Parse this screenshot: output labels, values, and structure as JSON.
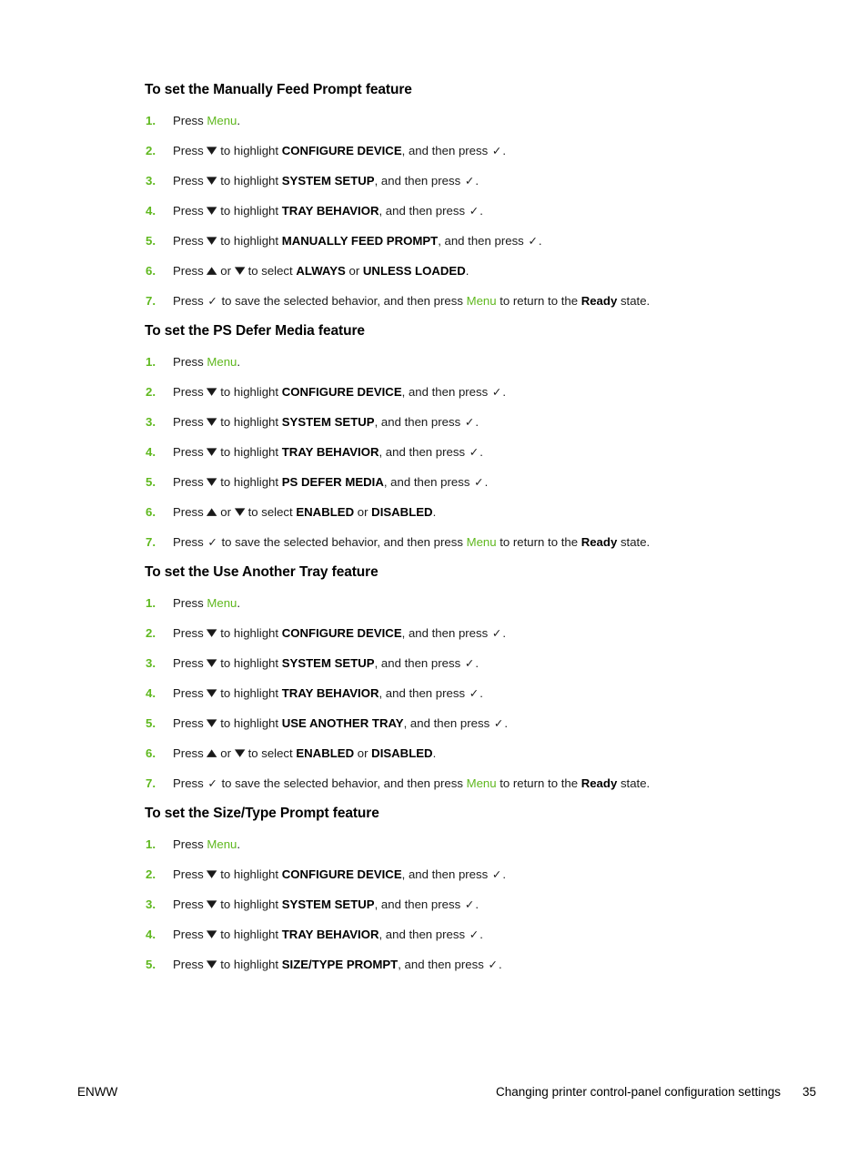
{
  "page": {
    "background_color": "#ffffff",
    "accent_green": "#5FB81E"
  },
  "glyphs": {
    "down_arrow": "▼",
    "up_arrow": "▲",
    "check": "✓"
  },
  "sections": [
    {
      "heading": "To set the Manually Feed Prompt feature",
      "steps": [
        {
          "number": "1.",
          "parts": [
            {
              "type": "text",
              "value": "Press "
            },
            {
              "type": "menu",
              "value": "Menu"
            },
            {
              "type": "text",
              "value": "."
            }
          ]
        },
        {
          "number": "2.",
          "parts": [
            {
              "type": "text",
              "value": "Press "
            },
            {
              "type": "glyph",
              "value": "down_arrow"
            },
            {
              "type": "text",
              "value": " to highlight "
            },
            {
              "type": "bold",
              "value": "CONFIGURE DEVICE"
            },
            {
              "type": "text",
              "value": ", and then press "
            },
            {
              "type": "glyph",
              "value": "check"
            },
            {
              "type": "text",
              "value": "."
            }
          ]
        },
        {
          "number": "3.",
          "parts": [
            {
              "type": "text",
              "value": "Press "
            },
            {
              "type": "glyph",
              "value": "down_arrow"
            },
            {
              "type": "text",
              "value": " to highlight "
            },
            {
              "type": "bold",
              "value": "SYSTEM SETUP"
            },
            {
              "type": "text",
              "value": ", and then press "
            },
            {
              "type": "glyph",
              "value": "check"
            },
            {
              "type": "text",
              "value": "."
            }
          ]
        },
        {
          "number": "4.",
          "parts": [
            {
              "type": "text",
              "value": "Press "
            },
            {
              "type": "glyph",
              "value": "down_arrow"
            },
            {
              "type": "text",
              "value": " to highlight "
            },
            {
              "type": "bold",
              "value": "TRAY BEHAVIOR"
            },
            {
              "type": "text",
              "value": ", and then press "
            },
            {
              "type": "glyph",
              "value": "check"
            },
            {
              "type": "text",
              "value": "."
            }
          ]
        },
        {
          "number": "5.",
          "parts": [
            {
              "type": "text",
              "value": "Press "
            },
            {
              "type": "glyph",
              "value": "down_arrow"
            },
            {
              "type": "text",
              "value": " to highlight "
            },
            {
              "type": "bold",
              "value": "MANUALLY FEED PROMPT"
            },
            {
              "type": "text",
              "value": ", and then press "
            },
            {
              "type": "glyph",
              "value": "check"
            },
            {
              "type": "text",
              "value": "."
            }
          ]
        },
        {
          "number": "6.",
          "parts": [
            {
              "type": "text",
              "value": "Press "
            },
            {
              "type": "glyph",
              "value": "up_arrow"
            },
            {
              "type": "text",
              "value": " or "
            },
            {
              "type": "glyph",
              "value": "down_arrow"
            },
            {
              "type": "text",
              "value": " to select "
            },
            {
              "type": "bold",
              "value": "ALWAYS"
            },
            {
              "type": "text",
              "value": " or "
            },
            {
              "type": "bold",
              "value": "UNLESS LOADED"
            },
            {
              "type": "text",
              "value": "."
            }
          ]
        },
        {
          "number": "7.",
          "parts": [
            {
              "type": "text",
              "value": "Press "
            },
            {
              "type": "glyph",
              "value": "check"
            },
            {
              "type": "text",
              "value": " to save the selected behavior, and then press "
            },
            {
              "type": "menu",
              "value": "Menu"
            },
            {
              "type": "text",
              "value": " to return to the "
            },
            {
              "type": "bold",
              "value": "Ready"
            },
            {
              "type": "text",
              "value": " state."
            }
          ]
        }
      ]
    },
    {
      "heading": "To set the PS Defer Media feature",
      "steps": [
        {
          "number": "1.",
          "parts": [
            {
              "type": "text",
              "value": "Press "
            },
            {
              "type": "menu",
              "value": "Menu"
            },
            {
              "type": "text",
              "value": "."
            }
          ]
        },
        {
          "number": "2.",
          "parts": [
            {
              "type": "text",
              "value": "Press "
            },
            {
              "type": "glyph",
              "value": "down_arrow"
            },
            {
              "type": "text",
              "value": " to highlight "
            },
            {
              "type": "bold",
              "value": "CONFIGURE DEVICE"
            },
            {
              "type": "text",
              "value": ", and then press "
            },
            {
              "type": "glyph",
              "value": "check"
            },
            {
              "type": "text",
              "value": "."
            }
          ]
        },
        {
          "number": "3.",
          "parts": [
            {
              "type": "text",
              "value": "Press "
            },
            {
              "type": "glyph",
              "value": "down_arrow"
            },
            {
              "type": "text",
              "value": " to highlight "
            },
            {
              "type": "bold",
              "value": "SYSTEM SETUP"
            },
            {
              "type": "text",
              "value": ", and then press "
            },
            {
              "type": "glyph",
              "value": "check"
            },
            {
              "type": "text",
              "value": "."
            }
          ]
        },
        {
          "number": "4.",
          "parts": [
            {
              "type": "text",
              "value": "Press "
            },
            {
              "type": "glyph",
              "value": "down_arrow"
            },
            {
              "type": "text",
              "value": " to highlight "
            },
            {
              "type": "bold",
              "value": "TRAY BEHAVIOR"
            },
            {
              "type": "text",
              "value": ", and then press "
            },
            {
              "type": "glyph",
              "value": "check"
            },
            {
              "type": "text",
              "value": "."
            }
          ]
        },
        {
          "number": "5.",
          "parts": [
            {
              "type": "text",
              "value": "Press "
            },
            {
              "type": "glyph",
              "value": "down_arrow"
            },
            {
              "type": "text",
              "value": " to highlight "
            },
            {
              "type": "bold",
              "value": "PS DEFER MEDIA"
            },
            {
              "type": "text",
              "value": ", and then press "
            },
            {
              "type": "glyph",
              "value": "check"
            },
            {
              "type": "text",
              "value": "."
            }
          ]
        },
        {
          "number": "6.",
          "parts": [
            {
              "type": "text",
              "value": "Press "
            },
            {
              "type": "glyph",
              "value": "up_arrow"
            },
            {
              "type": "text",
              "value": " or "
            },
            {
              "type": "glyph",
              "value": "down_arrow"
            },
            {
              "type": "text",
              "value": " to select "
            },
            {
              "type": "bold",
              "value": "ENABLED"
            },
            {
              "type": "text",
              "value": " or "
            },
            {
              "type": "bold",
              "value": "DISABLED"
            },
            {
              "type": "text",
              "value": "."
            }
          ]
        },
        {
          "number": "7.",
          "parts": [
            {
              "type": "text",
              "value": "Press "
            },
            {
              "type": "glyph",
              "value": "check"
            },
            {
              "type": "text",
              "value": " to save the selected behavior, and then press "
            },
            {
              "type": "menu",
              "value": "Menu"
            },
            {
              "type": "text",
              "value": " to return to the "
            },
            {
              "type": "bold",
              "value": "Ready"
            },
            {
              "type": "text",
              "value": " state."
            }
          ]
        }
      ]
    },
    {
      "heading": "To set the Use Another Tray feature",
      "steps": [
        {
          "number": "1.",
          "parts": [
            {
              "type": "text",
              "value": "Press "
            },
            {
              "type": "menu",
              "value": "Menu"
            },
            {
              "type": "text",
              "value": "."
            }
          ]
        },
        {
          "number": "2.",
          "parts": [
            {
              "type": "text",
              "value": "Press "
            },
            {
              "type": "glyph",
              "value": "down_arrow"
            },
            {
              "type": "text",
              "value": " to highlight "
            },
            {
              "type": "bold",
              "value": "CONFIGURE DEVICE"
            },
            {
              "type": "text",
              "value": ", and then press "
            },
            {
              "type": "glyph",
              "value": "check"
            },
            {
              "type": "text",
              "value": "."
            }
          ]
        },
        {
          "number": "3.",
          "parts": [
            {
              "type": "text",
              "value": "Press "
            },
            {
              "type": "glyph",
              "value": "down_arrow"
            },
            {
              "type": "text",
              "value": " to highlight "
            },
            {
              "type": "bold",
              "value": "SYSTEM SETUP"
            },
            {
              "type": "text",
              "value": ", and then press "
            },
            {
              "type": "glyph",
              "value": "check"
            },
            {
              "type": "text",
              "value": "."
            }
          ]
        },
        {
          "number": "4.",
          "parts": [
            {
              "type": "text",
              "value": "Press "
            },
            {
              "type": "glyph",
              "value": "down_arrow"
            },
            {
              "type": "text",
              "value": " to highlight "
            },
            {
              "type": "bold",
              "value": "TRAY BEHAVIOR"
            },
            {
              "type": "text",
              "value": ", and then press "
            },
            {
              "type": "glyph",
              "value": "check"
            },
            {
              "type": "text",
              "value": "."
            }
          ]
        },
        {
          "number": "5.",
          "parts": [
            {
              "type": "text",
              "value": "Press "
            },
            {
              "type": "glyph",
              "value": "down_arrow"
            },
            {
              "type": "text",
              "value": " to highlight "
            },
            {
              "type": "bold",
              "value": "USE ANOTHER TRAY"
            },
            {
              "type": "text",
              "value": ", and then press "
            },
            {
              "type": "glyph",
              "value": "check"
            },
            {
              "type": "text",
              "value": "."
            }
          ]
        },
        {
          "number": "6.",
          "parts": [
            {
              "type": "text",
              "value": "Press "
            },
            {
              "type": "glyph",
              "value": "up_arrow"
            },
            {
              "type": "text",
              "value": " or "
            },
            {
              "type": "glyph",
              "value": "down_arrow"
            },
            {
              "type": "text",
              "value": " to select "
            },
            {
              "type": "bold",
              "value": "ENABLED"
            },
            {
              "type": "text",
              "value": " or "
            },
            {
              "type": "bold",
              "value": "DISABLED"
            },
            {
              "type": "text",
              "value": "."
            }
          ]
        },
        {
          "number": "7.",
          "parts": [
            {
              "type": "text",
              "value": "Press "
            },
            {
              "type": "glyph",
              "value": "check"
            },
            {
              "type": "text",
              "value": " to save the selected behavior, and then press "
            },
            {
              "type": "menu",
              "value": "Menu"
            },
            {
              "type": "text",
              "value": " to return to the "
            },
            {
              "type": "bold",
              "value": "Ready"
            },
            {
              "type": "text",
              "value": " state."
            }
          ]
        }
      ]
    },
    {
      "heading": "To set the Size/Type Prompt feature",
      "steps": [
        {
          "number": "1.",
          "parts": [
            {
              "type": "text",
              "value": "Press "
            },
            {
              "type": "menu",
              "value": "Menu"
            },
            {
              "type": "text",
              "value": "."
            }
          ]
        },
        {
          "number": "2.",
          "parts": [
            {
              "type": "text",
              "value": "Press "
            },
            {
              "type": "glyph",
              "value": "down_arrow"
            },
            {
              "type": "text",
              "value": " to highlight "
            },
            {
              "type": "bold",
              "value": "CONFIGURE DEVICE"
            },
            {
              "type": "text",
              "value": ", and then press "
            },
            {
              "type": "glyph",
              "value": "check"
            },
            {
              "type": "text",
              "value": "."
            }
          ]
        },
        {
          "number": "3.",
          "parts": [
            {
              "type": "text",
              "value": "Press "
            },
            {
              "type": "glyph",
              "value": "down_arrow"
            },
            {
              "type": "text",
              "value": " to highlight "
            },
            {
              "type": "bold",
              "value": "SYSTEM SETUP"
            },
            {
              "type": "text",
              "value": ", and then press "
            },
            {
              "type": "glyph",
              "value": "check"
            },
            {
              "type": "text",
              "value": "."
            }
          ]
        },
        {
          "number": "4.",
          "parts": [
            {
              "type": "text",
              "value": "Press "
            },
            {
              "type": "glyph",
              "value": "down_arrow"
            },
            {
              "type": "text",
              "value": " to highlight "
            },
            {
              "type": "bold",
              "value": "TRAY BEHAVIOR"
            },
            {
              "type": "text",
              "value": ", and then press "
            },
            {
              "type": "glyph",
              "value": "check"
            },
            {
              "type": "text",
              "value": "."
            }
          ]
        },
        {
          "number": "5.",
          "parts": [
            {
              "type": "text",
              "value": "Press "
            },
            {
              "type": "glyph",
              "value": "down_arrow"
            },
            {
              "type": "text",
              "value": " to highlight "
            },
            {
              "type": "bold",
              "value": "SIZE/TYPE PROMPT"
            },
            {
              "type": "text",
              "value": ", and then press "
            },
            {
              "type": "glyph",
              "value": "check"
            },
            {
              "type": "text",
              "value": "."
            }
          ]
        }
      ]
    }
  ],
  "footer": {
    "left_label": "ENWW",
    "title": "Changing printer control-panel configuration settings",
    "page_number": "35"
  }
}
